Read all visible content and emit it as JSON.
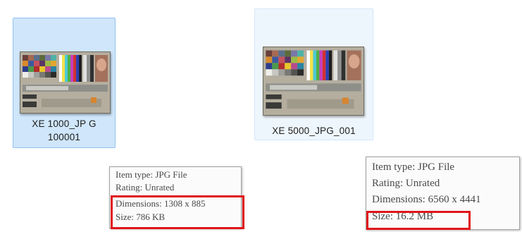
{
  "files": [
    {
      "name": "XE 1000_JPG 100001",
      "label_lines": [
        "XE 1000_JP G",
        "100001"
      ],
      "state": "selected",
      "tooltip": {
        "item_type": "Item type: JPG File",
        "rating": "Rating: Unrated",
        "dimensions": "Dimensions: 1308 x 885",
        "size": "Size: 786 KB"
      }
    },
    {
      "name": "XE 5000_JPG_001",
      "label_lines": [
        "XE 5000_JPG_001"
      ],
      "state": "hovered",
      "tooltip": {
        "item_type": "Item type: JPG File",
        "rating": "Rating: Unrated",
        "dimensions": "Dimensions: 6560 x 4441",
        "size": "Size: 16.2 MB"
      }
    }
  ],
  "colors": {
    "selection_bg": "#cfe6fb",
    "selection_border": "#92c2ef",
    "hover_bg": "#eef6fd",
    "highlight_red": "#e0161b"
  },
  "icons": [
    "jpg-thumbnail",
    "jpg-thumbnail"
  ]
}
